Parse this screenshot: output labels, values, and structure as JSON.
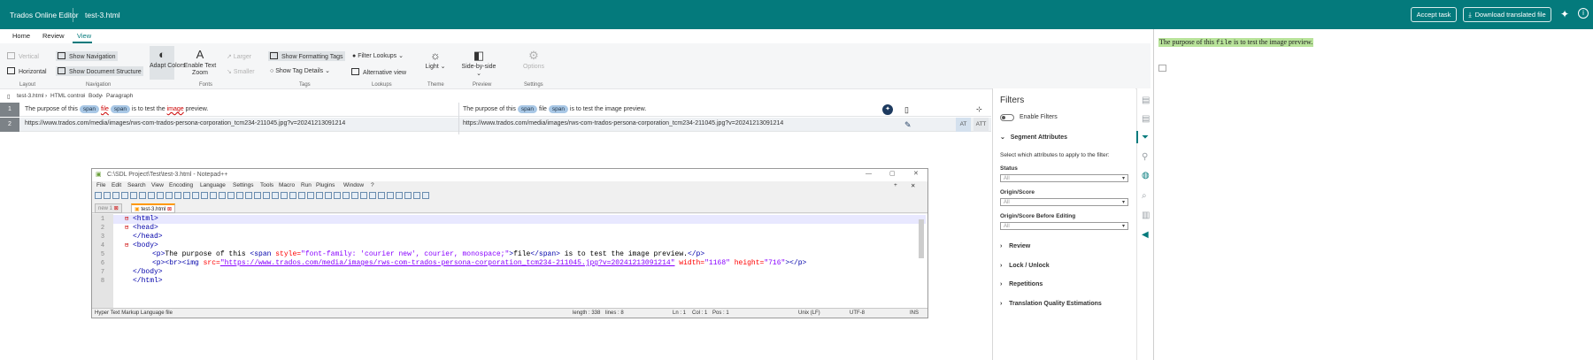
{
  "topbar": {
    "app_name": "Trados Online Editor",
    "file_name": "test-3.html",
    "accept_label": "Accept task",
    "download_label": "Download translated file",
    "accent": "#047a7c"
  },
  "nav_tabs": [
    "Home",
    "Review",
    "View"
  ],
  "ribbon": {
    "layout": {
      "vertical": "Vertical",
      "horizontal": "Horizontal",
      "group": "Layout"
    },
    "navigation": {
      "show_nav": "Show Navigation",
      "show_structure": "Show Document Structure",
      "group": "Navigation"
    },
    "fonts": {
      "adapt_colors": "Adapt Colors",
      "enable_text_zoom": "Enable Text Zoom",
      "larger": "Larger",
      "smaller": "Smaller",
      "group": "Fonts"
    },
    "tags": {
      "show_formatting": "Show Formatting Tags",
      "show_tag_details": "Show Tag Details",
      "group": "Tags"
    },
    "lookups": {
      "filter": "Filter Lookups",
      "alt_view": "Alternative view",
      "group": "Lookups"
    },
    "theme": {
      "light": "Light",
      "group": "Theme"
    },
    "preview": {
      "side_by_side": "Side-by-side",
      "group": "Preview"
    },
    "settings": {
      "options": "Options",
      "group": "Settings"
    }
  },
  "breadcrumb": {
    "file": "test-3.html",
    "control": "HTML control",
    "body": "Body",
    "para": "Paragraph"
  },
  "segments": [
    {
      "num": "1",
      "src_a": "The purpose of this",
      "tag1": "span",
      "src_word": "file",
      "tag2": "span",
      "src_b": "is to test the",
      "src_red": "image",
      "src_c": "preview.",
      "tgt_a": "The purpose of this",
      "tgt_tag1": "span",
      "tgt_word": "file",
      "tgt_tag2": "span",
      "tgt_b": "is to test the image preview."
    },
    {
      "num": "2",
      "src": "https://www.trados.com/media/images/rws-com-trados-persona-corporation_tcm234-211045.jpg?v=20241213091214",
      "tgt": "https://www.trados.com/media/images/rws-com-trados-persona-corporation_tcm234-211045.jpg?v=20241213091214",
      "status1": "AT",
      "status2": "ATT"
    }
  ],
  "notepad": {
    "title": "C:\\SDL Project\\Test\\test-3.html - Notepad++",
    "menu": [
      "File",
      "Edit",
      "Search",
      "View",
      "Encoding",
      "Language",
      "Settings",
      "Tools",
      "Macro",
      "Run",
      "Plugins",
      "Window",
      "?"
    ],
    "tabs": [
      "new 1",
      "test-3.html"
    ],
    "line_numbers": [
      "1",
      "2",
      "3",
      "4",
      "5",
      "6",
      "7",
      "8"
    ],
    "line1": "<html>",
    "line2": "<head>",
    "line3": "</head>",
    "line4": "<body>",
    "line5_a": "<p>",
    "line5_b": "The purpose of this ",
    "line5_c": "<span ",
    "line5_d": "style=",
    "line5_e": "\"font-family: 'courier new', courier, monospace;\"",
    "line5_f": ">",
    "line5_g": "file",
    "line5_h": "</span>",
    "line5_i": " is to test the image preview.",
    "line5_j": "</p>",
    "line6_a": "<p><br><img ",
    "line6_b": "src=",
    "line6_c": "\"https://www.trados.com/media/images/rws-com-trados-persona-corporation_tcm234-211045.jpg?v=20241213091214\"",
    "line6_d": " width=",
    "line6_e": "\"1168\"",
    "line6_f": " height=",
    "line6_g": "\"716\"",
    "line6_h": "></p>",
    "line7": "</body>",
    "line8": "</html>",
    "status": {
      "type": "Hyper Text Markup Language file",
      "length": "length : 338",
      "lines": "lines : 8",
      "ln": "Ln : 1",
      "col": "Col : 1",
      "pos": "Pos : 1",
      "eol": "Unix (LF)",
      "enc": "UTF-8",
      "mode": "INS"
    }
  },
  "filters": {
    "title": "Filters",
    "enable": "Enable Filters",
    "seg_attr": "Segment Attributes",
    "desc": "Select which attributes to apply to the filter:",
    "status_label": "Status",
    "status_value": "All",
    "origin_label": "Origin/Score",
    "origin_value": "All",
    "origin_before_label": "Origin/Score Before Editing",
    "origin_before_value": "All",
    "sections": [
      "Review",
      "Lock / Unlock",
      "Repetitions",
      "Translation Quality Estimations"
    ]
  },
  "preview": {
    "text_a": "The purpose of this ",
    "text_mono": "file",
    "text_b": " is to test the image preview.",
    "highlight": "#b8e39a"
  }
}
